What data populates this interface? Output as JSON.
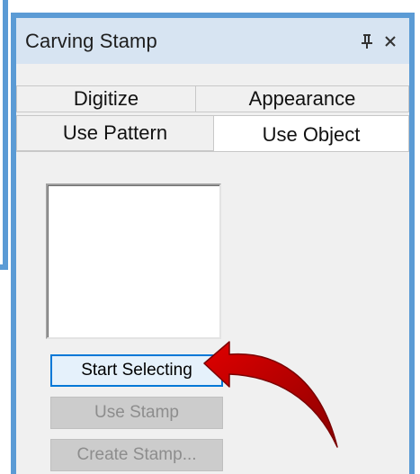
{
  "panel": {
    "title": "Carving Stamp",
    "pin_icon": "pin-icon",
    "close_icon": "close-icon"
  },
  "tabs": {
    "back": [
      {
        "label": "Digitize"
      },
      {
        "label": "Appearance"
      }
    ],
    "front": [
      {
        "label": "Use Pattern"
      },
      {
        "label": "Use Object",
        "active": true
      }
    ]
  },
  "buttons": {
    "start_selecting": "Start Selecting",
    "use_stamp": "Use Stamp",
    "create_stamp": "Create Stamp..."
  },
  "annotation": {
    "arrow_icon": "red-arrow-icon",
    "arrow_color": "#c00000"
  },
  "colors": {
    "frame": "#5b9bd5",
    "titlebar": "#d7e4f2",
    "focus": "#0078d7"
  }
}
